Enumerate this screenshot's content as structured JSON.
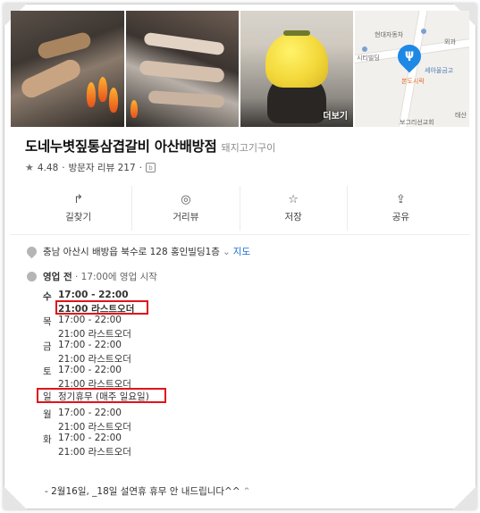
{
  "photos": {
    "more_label": "더보기",
    "map_labels": [
      "시티빌딩",
      "세아울금고",
      "현대자동차",
      "외과",
      "본도시락",
      "태산",
      "보그리선교회"
    ]
  },
  "place": {
    "name": "도네누볏짚통삼겹갈비 아산배방점",
    "category": "돼지고기구이",
    "rating": "4.48",
    "review_text": "방문자 리뷰 217",
    "rating_separator": "·"
  },
  "actions": [
    {
      "label": "길찾기",
      "icon": "directions-icon",
      "glyph": "↱"
    },
    {
      "label": "거리뷰",
      "icon": "streetview-icon",
      "glyph": "◎"
    },
    {
      "label": "저장",
      "icon": "star-outline-icon",
      "glyph": "☆"
    },
    {
      "label": "공유",
      "icon": "share-icon",
      "glyph": "⇪"
    }
  ],
  "address": {
    "text": "충남 아산시 배방읍 북수로 128 홍인빌딩1층",
    "map_link": "지도"
  },
  "status": {
    "state": "영업 전",
    "detail": " · 17:00에 영업 시작"
  },
  "hours": [
    {
      "day": "수",
      "hours": "17:00 - 22:00",
      "last_order": "21:00 라스트오더",
      "today": true
    },
    {
      "day": "목",
      "hours": "17:00 - 22:00",
      "last_order": "21:00 라스트오더"
    },
    {
      "day": "금",
      "hours": "17:00 - 22:00",
      "last_order": "21:00 라스트오더"
    },
    {
      "day": "토",
      "hours": "17:00 - 22:00",
      "last_order": "21:00 라스트오더"
    },
    {
      "day": "일",
      "hours": "정기휴무 (매주 일요일)"
    },
    {
      "day": "월",
      "hours": "17:00 - 22:00",
      "last_order": "21:00 라스트오더"
    },
    {
      "day": "화",
      "hours": "17:00 - 22:00",
      "last_order": "21:00 라스트오더"
    }
  ],
  "note": "- 2월16일, _18일 설연휴 휴무 안 내드립니다^^",
  "colors": {
    "highlight": "#e0141c",
    "link": "#1a6fd1",
    "pin": "#1e88e5"
  }
}
